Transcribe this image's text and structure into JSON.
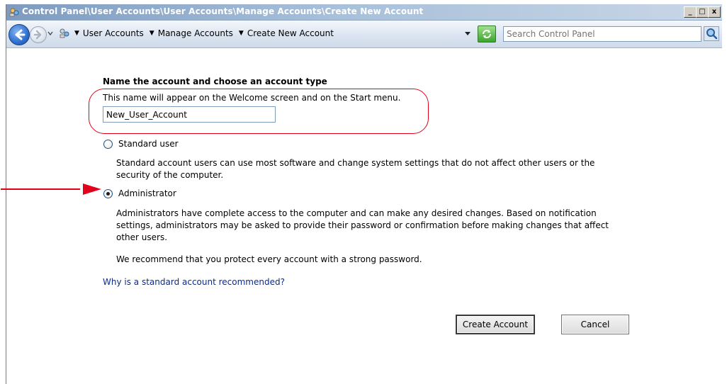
{
  "window": {
    "title": "Control Panel\\User Accounts\\User Accounts\\Manage Accounts\\Create New Account",
    "controls": {
      "minimize": "_",
      "maximize": "□",
      "close": "x"
    }
  },
  "toolbar": {
    "breadcrumbs": [
      "User Accounts",
      "Manage Accounts",
      "Create New Account"
    ],
    "search_placeholder": "Search Control Panel"
  },
  "form": {
    "heading": "Name the account and choose an account type",
    "description": "This name will appear on the Welcome screen and on the Start menu.",
    "account_name": "New_User_Account",
    "options": [
      {
        "label": "Standard user",
        "selected": false,
        "description": "Standard account users can use most software and change system settings that do not affect other users or the security of the computer."
      },
      {
        "label": "Administrator",
        "selected": true,
        "description": "Administrators have complete access to the computer and can make any desired changes. Based on notification settings, administrators may be asked to provide their password or confirmation before making changes that affect other users."
      }
    ],
    "recommendation": "We recommend that you protect every account with a strong password.",
    "help_link": "Why is a standard account recommended?",
    "create_button": "Create Account",
    "cancel_button": "Cancel"
  },
  "colors": {
    "annotation": "#e3001b",
    "link": "#0a2a8c"
  },
  "icons": {
    "back": "back-arrow-icon",
    "forward": "forward-arrow-icon",
    "control_panel": "control-panel-icon",
    "refresh": "refresh-icon",
    "search": "search-icon"
  }
}
